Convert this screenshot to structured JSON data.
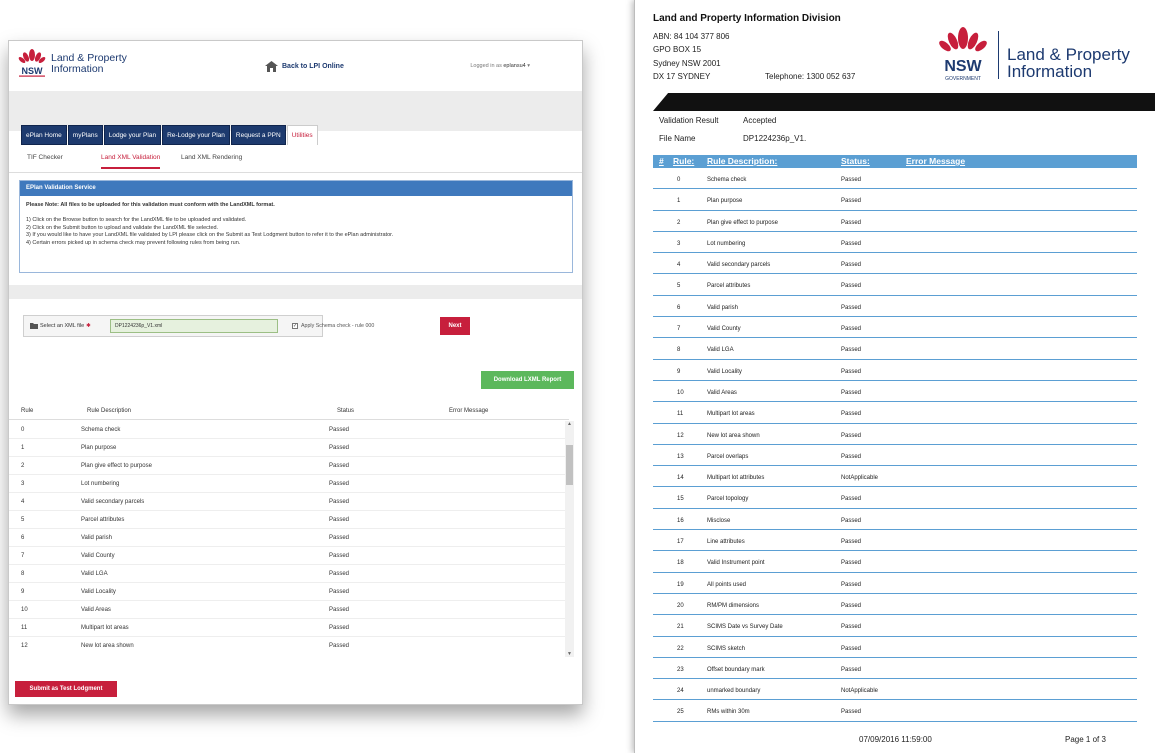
{
  "app": {
    "brand_line1": "Land & Property",
    "brand_line2": "Information",
    "back_label": "Back to LPI Online",
    "logged_in_label": "Logged in as",
    "username": "eplansu4",
    "main_nav": [
      {
        "label": "ePlan Home"
      },
      {
        "label": "myPlans"
      },
      {
        "label": "Lodge your Plan"
      },
      {
        "label": "Re-Lodge your Plan"
      },
      {
        "label": "Request a PPN"
      },
      {
        "label": "Utilities"
      }
    ],
    "sub_nav": [
      {
        "label": "TIF Checker"
      },
      {
        "label": "Land XML Validation"
      },
      {
        "label": "Land XML Rendering"
      }
    ],
    "panel": {
      "title": "EPlan Validation Service",
      "note": "Please Note: All files to be uploaded for this validation must conform with the LandXML format.",
      "steps": [
        "1) Click on the Browse button to search for the LandXML file to be uploaded and validated.",
        "2) Click on the Submit button to upload and validate the LandXML file selected.",
        "3) If you would like to have your LandXML file validated by LPI please click on the Submit as Test Lodgment button to refer it to the ePlan administrator.",
        "4) Certain errors picked up in schema check may prevent following rules from being run."
      ]
    },
    "file_label": "Select an XML file",
    "file_name": "DP1224236p_V1.xml",
    "schema_label": "Apply Schema check - rule 000",
    "next_label": "Next",
    "download_label": "Download LXML Report",
    "columns": [
      "Rule",
      "Rule Description",
      "Status",
      "Error Message"
    ],
    "rows": [
      {
        "rule": "0",
        "desc": "Schema check",
        "status": "Passed"
      },
      {
        "rule": "1",
        "desc": "Plan purpose",
        "status": "Passed"
      },
      {
        "rule": "2",
        "desc": "Plan give effect to purpose",
        "status": "Passed"
      },
      {
        "rule": "3",
        "desc": "Lot numbering",
        "status": "Passed"
      },
      {
        "rule": "4",
        "desc": "Valid secondary parcels",
        "status": "Passed"
      },
      {
        "rule": "5",
        "desc": "Parcel attributes",
        "status": "Passed"
      },
      {
        "rule": "6",
        "desc": "Valid parish",
        "status": "Passed"
      },
      {
        "rule": "7",
        "desc": "Valid County",
        "status": "Passed"
      },
      {
        "rule": "8",
        "desc": "Valid LGA",
        "status": "Passed"
      },
      {
        "rule": "9",
        "desc": "Valid Locality",
        "status": "Passed"
      },
      {
        "rule": "10",
        "desc": "Valid Areas",
        "status": "Passed"
      },
      {
        "rule": "11",
        "desc": "Multipart lot areas",
        "status": "Passed"
      },
      {
        "rule": "12",
        "desc": "New lot area shown",
        "status": "Passed"
      }
    ],
    "submit_label": "Submit as Test Lodgment"
  },
  "report": {
    "division": "Land and Property Information Division",
    "address": [
      "ABN: 84 104 377 806",
      "GPO BOX 15",
      "Sydney NSW 2001",
      "DX 17 SYDNEY"
    ],
    "telephone": "Telephone: 1300 052 637",
    "logo_nsw": "NSW",
    "logo_gov": "GOVERNMENT",
    "brand_line1": "Land & Property",
    "brand_line2": "Information",
    "validation_label": "Validation Result",
    "validation_value": "Accepted",
    "file_label": "File Name",
    "file_value": "DP1224236p_V1.",
    "columns": [
      "#",
      "Rule:",
      "Rule Description:",
      "Status:",
      "Error Message"
    ],
    "rows": [
      {
        "rule": "0",
        "desc": "Schema check",
        "status": "Passed"
      },
      {
        "rule": "1",
        "desc": "Plan purpose",
        "status": "Passed"
      },
      {
        "rule": "2",
        "desc": "Plan give effect to purpose",
        "status": "Passed"
      },
      {
        "rule": "3",
        "desc": "Lot numbering",
        "status": "Passed"
      },
      {
        "rule": "4",
        "desc": "Valid secondary parcels",
        "status": "Passed"
      },
      {
        "rule": "5",
        "desc": "Parcel attributes",
        "status": "Passed"
      },
      {
        "rule": "6",
        "desc": "Valid parish",
        "status": "Passed"
      },
      {
        "rule": "7",
        "desc": "Valid County",
        "status": "Passed"
      },
      {
        "rule": "8",
        "desc": "Valid LGA",
        "status": "Passed"
      },
      {
        "rule": "9",
        "desc": "Valid Locality",
        "status": "Passed"
      },
      {
        "rule": "10",
        "desc": "Valid Areas",
        "status": "Passed"
      },
      {
        "rule": "11",
        "desc": "Multipart lot areas",
        "status": "Passed"
      },
      {
        "rule": "12",
        "desc": "New lot area shown",
        "status": "Passed"
      },
      {
        "rule": "13",
        "desc": "Parcel overlaps",
        "status": "Passed"
      },
      {
        "rule": "14",
        "desc": "Multipart lot attributes",
        "status": "NotApplicable"
      },
      {
        "rule": "15",
        "desc": "Parcel topology",
        "status": "Passed"
      },
      {
        "rule": "16",
        "desc": "Misclose",
        "status": "Passed"
      },
      {
        "rule": "17",
        "desc": "Line attributes",
        "status": "Passed"
      },
      {
        "rule": "18",
        "desc": "Valid Instrument point",
        "status": "Passed"
      },
      {
        "rule": "19",
        "desc": "All points used",
        "status": "Passed"
      },
      {
        "rule": "20",
        "desc": "RM/PM dimensions",
        "status": "Passed"
      },
      {
        "rule": "21",
        "desc": "SCIMS Date vs  Survey Date",
        "status": "Passed"
      },
      {
        "rule": "22",
        "desc": "SCIMS sketch",
        "status": "Passed"
      },
      {
        "rule": "23",
        "desc": "Offset boundary mark",
        "status": "Passed"
      },
      {
        "rule": "24",
        "desc": "unmarked boundary",
        "status": "NotApplicable"
      },
      {
        "rule": "25",
        "desc": "RMs within 30m",
        "status": "Passed"
      }
    ],
    "footer_date": "07/09/2016 11:59:00",
    "footer_page": "Page 1 of 3"
  },
  "colors": {
    "nsw_red": "#c71f3c",
    "nsw_navy": "#1d3a70",
    "panel_blue": "#3f79bd",
    "report_header_blue": "#5b9fd3",
    "download_green": "#5cb85c"
  },
  "icons": [
    "waratah-logo-icon",
    "home-icon",
    "folder-icon",
    "scroll-up-icon",
    "scroll-down-icon"
  ]
}
